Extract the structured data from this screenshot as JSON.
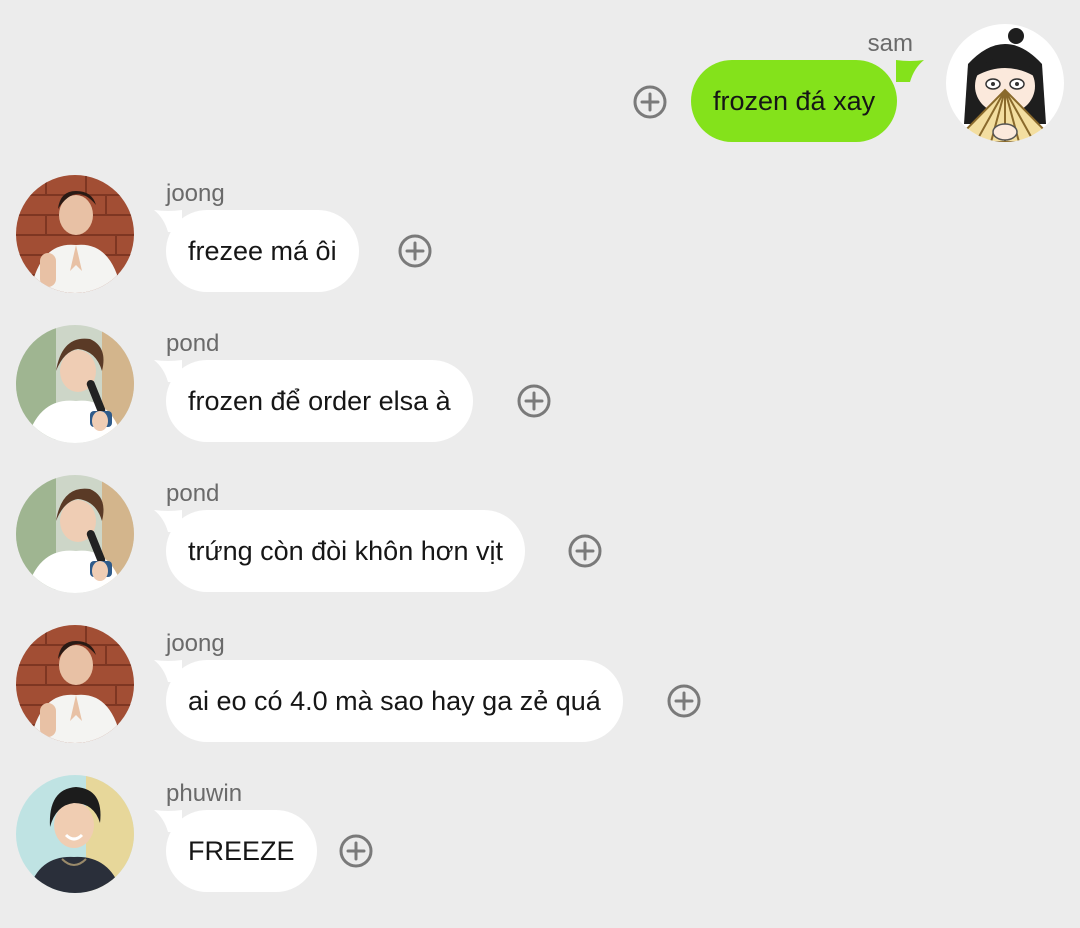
{
  "theme": {
    "background": "#ececec",
    "incoming_bubble": "#ffffff",
    "outgoing_bubble": "#84e21b",
    "text": "#161616",
    "sender_name": "#6a6a6a",
    "react_icon": "#7a7a7a"
  },
  "messages": [
    {
      "direction": "outgoing",
      "sender": "sam",
      "text": "frozen đá xay",
      "avatar": "cartoon-girl-fan",
      "react_icon": "add-reaction-icon"
    },
    {
      "direction": "incoming",
      "sender": "joong",
      "text": "frezee má ôi",
      "avatar": "joong-photo",
      "react_icon": "add-reaction-icon"
    },
    {
      "direction": "incoming",
      "sender": "pond",
      "text": "frozen để order elsa à",
      "avatar": "pond-photo",
      "react_icon": "add-reaction-icon"
    },
    {
      "direction": "incoming",
      "sender": "pond",
      "text": "trứng còn đòi khôn hơn vịt",
      "avatar": "pond-photo",
      "react_icon": "add-reaction-icon"
    },
    {
      "direction": "incoming",
      "sender": "joong",
      "text": "ai eo có 4.0 mà sao hay ga zẻ quá",
      "avatar": "joong-photo",
      "react_icon": "add-reaction-icon"
    },
    {
      "direction": "incoming",
      "sender": "phuwin",
      "text": "FREEZE",
      "avatar": "phuwin-photo",
      "react_icon": "add-reaction-icon"
    }
  ]
}
